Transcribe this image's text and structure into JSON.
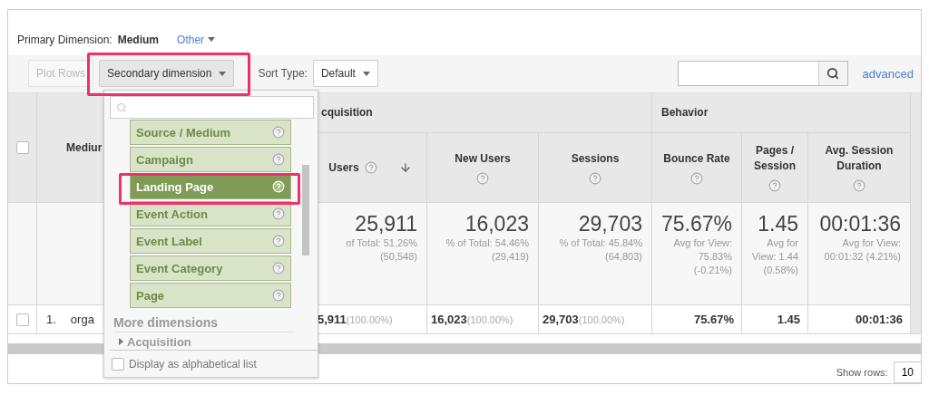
{
  "primary_dimension": {
    "label": "Primary Dimension:",
    "value": "Medium",
    "other": "Other"
  },
  "toolbar": {
    "plot_rows": "Plot Rows",
    "secondary_dimension": "Secondary dimension",
    "sort_type_label": "Sort Type:",
    "sort_type": "Default",
    "advanced": "advanced"
  },
  "table": {
    "header_checkbox": {
      "checked": false
    },
    "dimension_header": "Mediur",
    "groups": [
      {
        "label": "cquisition"
      },
      {
        "label": "Behavior"
      }
    ],
    "columns": [
      {
        "label": "Users",
        "sorted": true
      },
      {
        "label": "New Users",
        "sorted": false
      },
      {
        "label": "Sessions",
        "sorted": false
      },
      {
        "label": "Bounce Rate",
        "sorted": false
      },
      {
        "label": "Pages / Session",
        "sorted": false
      },
      {
        "label": "Avg. Session Duration",
        "sorted": false
      }
    ],
    "totals": [
      {
        "value": "25,911",
        "note": "of Total: 51.26% (50,548)"
      },
      {
        "value": "16,023",
        "note": "% of Total: 54.46% (29,419)"
      },
      {
        "value": "29,703",
        "note": "% of Total: 45.84% (64,803)"
      },
      {
        "value": "75.67%",
        "note": "Avg for View: 75.83% (-0.21%)"
      },
      {
        "value": "1.45",
        "note": "Avg for View: 1.44 (0.58%)"
      },
      {
        "value": "00:01:36",
        "note": "Avg for View: 00:01:32 (4.21%)"
      }
    ],
    "rows": [
      {
        "checked": false,
        "index": "1.",
        "dimension": "orga",
        "cells": [
          {
            "value": "5,911",
            "share": "(100.00%)"
          },
          {
            "value": "16,023",
            "share": "(100.00%)"
          },
          {
            "value": "29,703",
            "share": "(100.00%)"
          },
          {
            "value": "75.67%"
          },
          {
            "value": "1.45"
          },
          {
            "value": "00:01:36"
          }
        ]
      }
    ]
  },
  "dropdown": {
    "items": [
      {
        "label": "Source / Medium",
        "selected": false
      },
      {
        "label": "Campaign",
        "selected": false
      },
      {
        "label": "Landing Page",
        "selected": true
      },
      {
        "label": "Event Action",
        "selected": false
      },
      {
        "label": "Event Label",
        "selected": false
      },
      {
        "label": "Event Category",
        "selected": false
      },
      {
        "label": "Page",
        "selected": false
      }
    ],
    "section": "More dimensions",
    "subsection": "Acquisition",
    "alphabetical": {
      "label": "Display as alphabetical list",
      "checked": false
    }
  },
  "footer": {
    "show_rows_label": "Show rows:",
    "show_rows": "10"
  }
}
